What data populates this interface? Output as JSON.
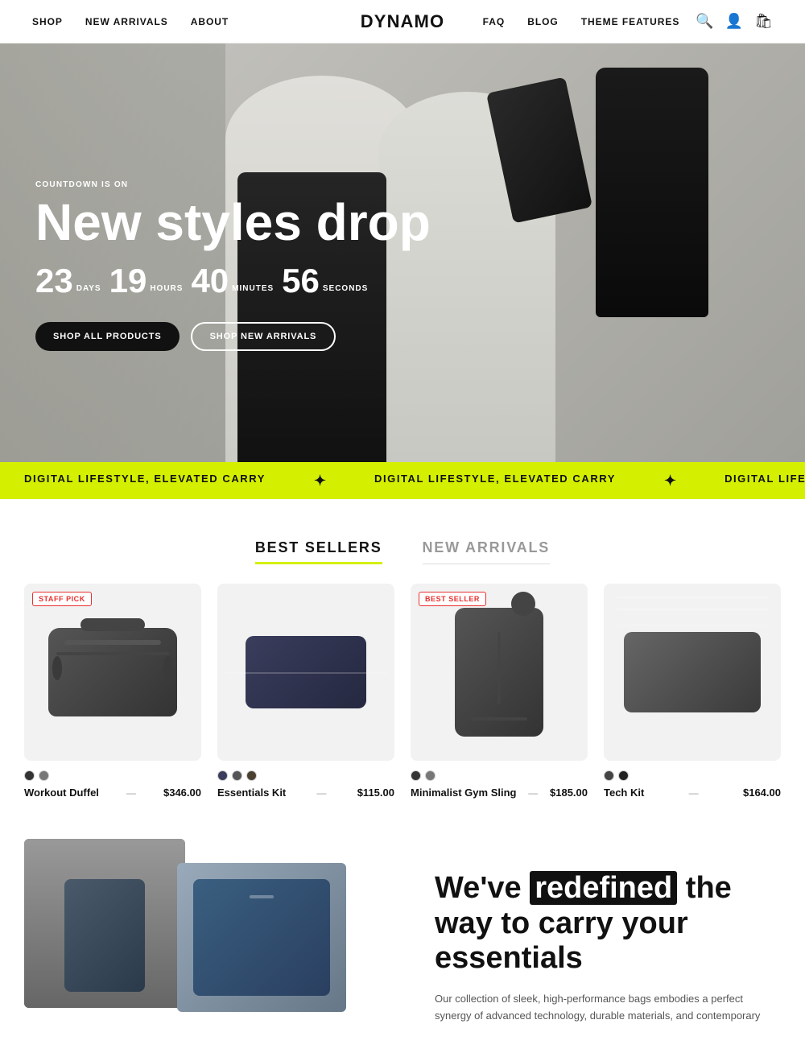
{
  "nav": {
    "left_links": [
      {
        "label": "SHOP",
        "href": "#"
      },
      {
        "label": "NEW ARRIVALS",
        "href": "#"
      },
      {
        "label": "ABOUT",
        "href": "#"
      }
    ],
    "logo": "DYNAMO",
    "right_links": [
      {
        "label": "FAQ",
        "href": "#"
      },
      {
        "label": "BLOG",
        "href": "#"
      },
      {
        "label": "THEME FEATURES",
        "href": "#"
      }
    ],
    "icons": [
      "search",
      "account",
      "cart"
    ]
  },
  "hero": {
    "countdown_label": "COUNTDOWN IS ON",
    "title": "New styles drop",
    "timer": {
      "days_num": "23",
      "days_label": "DAYS",
      "hours_num": "19",
      "hours_label": "HOURS",
      "minutes_num": "40",
      "minutes_label": "MINUTES",
      "seconds_num": "56",
      "seconds_label": "SECONDS"
    },
    "btn_primary": "SHOP ALL PRODUCTS",
    "btn_secondary": "SHOP NEW ARRIVALS"
  },
  "ticker": {
    "texts": [
      "DIGITAL LIFESTYLE, ELEVATED CARRY",
      "DIGITAL LIFESTYLE, ELEVATED CARRY",
      "DIGITAL LIFESTYLE, ELEVATED CARRY",
      "DIGITAL LIFESTYLE, ELEVATED CARRY",
      "DIGITAL LIFESTYLE, ELEVATED CARRY",
      "DIGITAL LIFESTYLE, ELEVATED CARRY"
    ]
  },
  "tabs": {
    "items": [
      {
        "label": "BEST SELLERS",
        "active": true
      },
      {
        "label": "NEW ARRIVALS",
        "active": false
      }
    ]
  },
  "products": [
    {
      "badge": "STAFF PICK",
      "badge_type": "staff",
      "name": "Workout Duffel",
      "price": "$346.00",
      "colors": [
        "#333333",
        "#777777"
      ]
    },
    {
      "badge": null,
      "name": "Essentials Kit",
      "price": "$115.00",
      "colors": [
        "#3a3d5c",
        "#555555",
        "#4a4030"
      ]
    },
    {
      "badge": "BEST SELLER",
      "badge_type": "bestseller",
      "name": "Minimalist Gym Sling",
      "price": "$185.00",
      "colors": [
        "#333333",
        "#777777"
      ]
    },
    {
      "badge": null,
      "name": "Tech Kit",
      "price": "$164.00",
      "colors": [
        "#444444",
        "#222222"
      ]
    }
  ],
  "bottom": {
    "headline_pre": "We've",
    "headline_highlight": "redefined",
    "headline_post": "the way to carry your essentials",
    "body": "Our collection of sleek, high-performance bags embodies a perfect synergy of advanced technology, durable materials, and contemporary"
  }
}
